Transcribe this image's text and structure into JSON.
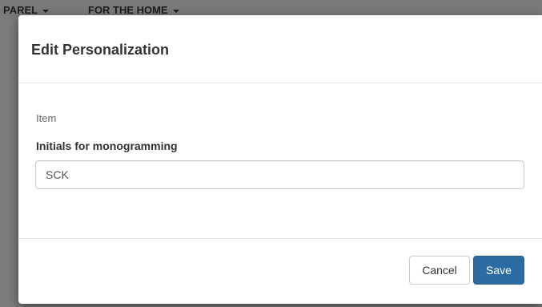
{
  "background": {
    "nav_items": [
      {
        "label": "PAREL"
      },
      {
        "label": "FOR THE HOME"
      }
    ]
  },
  "modal": {
    "title": "Edit Personalization",
    "item_label": "Item",
    "field_label": "Initials for monogramming",
    "field_value": "SCK",
    "cancel_label": "Cancel",
    "save_label": "Save"
  },
  "colors": {
    "primary": "#2d6ca2",
    "overlay": "#7a7a7a"
  }
}
